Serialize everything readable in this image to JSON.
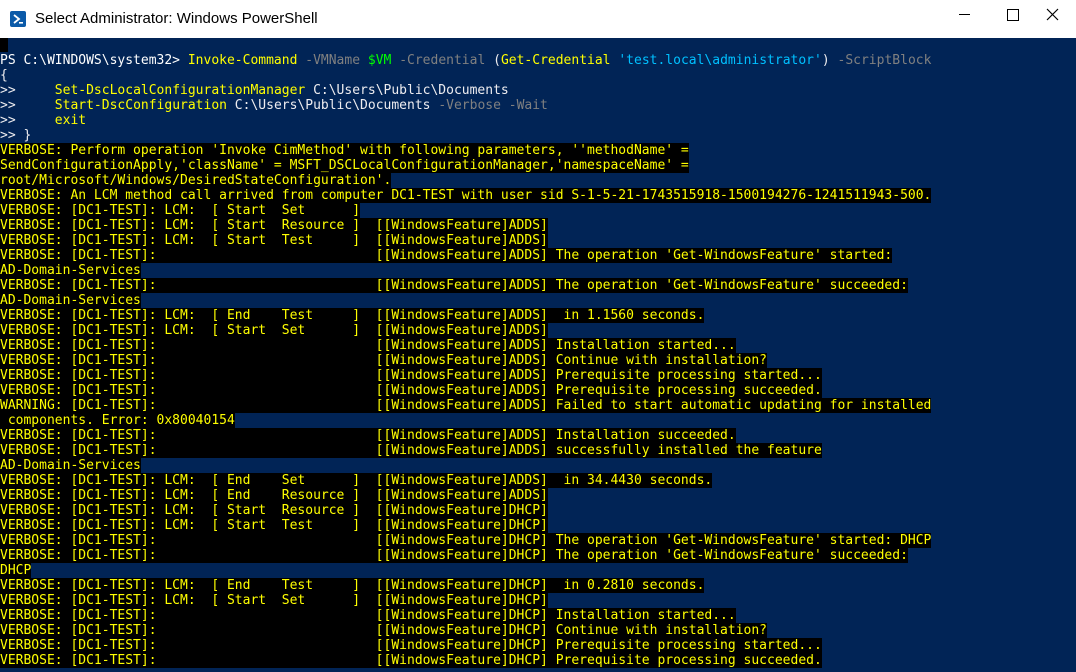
{
  "window": {
    "title": "Select Administrator: Windows PowerShell",
    "icons": {
      "app": "powershell-icon",
      "minimize": "minimize-icon",
      "maximize": "maximize-icon",
      "close": "close-icon"
    }
  },
  "console": {
    "prompt": "PS C:\\WINDOWS\\system32> ",
    "command_line": [
      {
        "t": "Invoke-Command",
        "c": "cmd"
      },
      {
        "t": " ",
        "c": "plain"
      },
      {
        "t": "-VMName",
        "c": "param"
      },
      {
        "t": " ",
        "c": "plain"
      },
      {
        "t": "$VM",
        "c": "var"
      },
      {
        "t": " ",
        "c": "plain"
      },
      {
        "t": "-Credential",
        "c": "param"
      },
      {
        "t": " (",
        "c": "plain"
      },
      {
        "t": "Get-Credential",
        "c": "cmd"
      },
      {
        "t": " ",
        "c": "plain"
      },
      {
        "t": "'test.local\\administrator'",
        "c": "str"
      },
      {
        "t": ") ",
        "c": "plain"
      },
      {
        "t": "-ScriptBlock",
        "c": "param"
      }
    ],
    "script_lines": [
      [
        {
          "t": "{",
          "c": "plain"
        }
      ],
      [
        {
          "t": ">>     ",
          "c": "plain"
        },
        {
          "t": "Set-DscLocalConfigurationManager",
          "c": "cmd"
        },
        {
          "t": " C:\\Users\\Public\\Documents",
          "c": "plain"
        }
      ],
      [
        {
          "t": ">>     ",
          "c": "plain"
        },
        {
          "t": "Start-DscConfiguration",
          "c": "cmd"
        },
        {
          "t": " C:\\Users\\Public\\Documents ",
          "c": "plain"
        },
        {
          "t": "-Verbose -Wait",
          "c": "param"
        }
      ],
      [
        {
          "t": ">>     ",
          "c": "plain"
        },
        {
          "t": "exit",
          "c": "kw"
        }
      ],
      [
        {
          "t": ">> }",
          "c": "plain"
        }
      ]
    ],
    "output_lines": [
      "VERBOSE: Perform operation 'Invoke CimMethod' with following parameters, ''methodName' =",
      "SendConfigurationApply,'className' = MSFT_DSCLocalConfigurationManager,'namespaceName' =",
      "root/Microsoft/Windows/DesiredStateConfiguration'.",
      "VERBOSE: An LCM method call arrived from computer DC1-TEST with user sid S-1-5-21-1743515918-1500194276-1241511943-500.",
      "VERBOSE: [DC1-TEST]: LCM:  [ Start  Set      ]",
      "VERBOSE: [DC1-TEST]: LCM:  [ Start  Resource ]  [[WindowsFeature]ADDS]",
      "VERBOSE: [DC1-TEST]: LCM:  [ Start  Test     ]  [[WindowsFeature]ADDS]",
      "VERBOSE: [DC1-TEST]:                            [[WindowsFeature]ADDS] The operation 'Get-WindowsFeature' started:",
      "AD-Domain-Services",
      "VERBOSE: [DC1-TEST]:                            [[WindowsFeature]ADDS] The operation 'Get-WindowsFeature' succeeded:",
      "AD-Domain-Services",
      "VERBOSE: [DC1-TEST]: LCM:  [ End    Test     ]  [[WindowsFeature]ADDS]  in 1.1560 seconds.",
      "VERBOSE: [DC1-TEST]: LCM:  [ Start  Set      ]  [[WindowsFeature]ADDS]",
      "VERBOSE: [DC1-TEST]:                            [[WindowsFeature]ADDS] Installation started...",
      "VERBOSE: [DC1-TEST]:                            [[WindowsFeature]ADDS] Continue with installation?",
      "VERBOSE: [DC1-TEST]:                            [[WindowsFeature]ADDS] Prerequisite processing started...",
      "VERBOSE: [DC1-TEST]:                            [[WindowsFeature]ADDS] Prerequisite processing succeeded.",
      "WARNING: [DC1-TEST]:                            [[WindowsFeature]ADDS] Failed to start automatic updating for installed",
      " components. Error: 0x80040154",
      "VERBOSE: [DC1-TEST]:                            [[WindowsFeature]ADDS] Installation succeeded.",
      "VERBOSE: [DC1-TEST]:                            [[WindowsFeature]ADDS] successfully installed the feature",
      "AD-Domain-Services",
      "VERBOSE: [DC1-TEST]: LCM:  [ End    Set      ]  [[WindowsFeature]ADDS]  in 34.4430 seconds.",
      "VERBOSE: [DC1-TEST]: LCM:  [ End    Resource ]  [[WindowsFeature]ADDS]",
      "VERBOSE: [DC1-TEST]: LCM:  [ Start  Resource ]  [[WindowsFeature]DHCP]",
      "VERBOSE: [DC1-TEST]: LCM:  [ Start  Test     ]  [[WindowsFeature]DHCP]",
      "VERBOSE: [DC1-TEST]:                            [[WindowsFeature]DHCP] The operation 'Get-WindowsFeature' started: DHCP",
      "VERBOSE: [DC1-TEST]:                            [[WindowsFeature]DHCP] The operation 'Get-WindowsFeature' succeeded:",
      "DHCP",
      "VERBOSE: [DC1-TEST]: LCM:  [ End    Test     ]  [[WindowsFeature]DHCP]  in 0.2810 seconds.",
      "VERBOSE: [DC1-TEST]: LCM:  [ Start  Set      ]  [[WindowsFeature]DHCP]",
      "VERBOSE: [DC1-TEST]:                            [[WindowsFeature]DHCP] Installation started...",
      "VERBOSE: [DC1-TEST]:                            [[WindowsFeature]DHCP] Continue with installation?",
      "VERBOSE: [DC1-TEST]:                            [[WindowsFeature]DHCP] Prerequisite processing started...",
      "VERBOSE: [DC1-TEST]:                            [[WindowsFeature]DHCP] Prerequisite processing succeeded."
    ]
  },
  "colors": {
    "console_background": "#012456",
    "verbose_foreground": "#ffff00",
    "verbose_background": "#000000",
    "command_color": "#ffff00",
    "parameter_color": "#808080",
    "variable_color": "#00ff00",
    "string_color": "#00c0ff"
  }
}
